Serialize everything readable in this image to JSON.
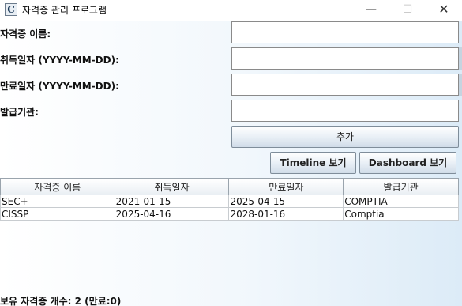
{
  "window": {
    "icon_letter": "C",
    "title": "자격증 관리 프로그램",
    "minimize_glyph": "—",
    "maximize_glyph": "☐",
    "close_glyph": "✕"
  },
  "form": {
    "name_label": "자격증 이름:",
    "name_value": "",
    "acquired_label": "취득일자 (YYYY-MM-DD):",
    "acquired_value": "",
    "expiry_label": "만료일자 (YYYY-MM-DD):",
    "expiry_value": "",
    "issuer_label": "발급기관:",
    "issuer_value": ""
  },
  "buttons": {
    "add": "추가",
    "timeline": "Timeline 보기",
    "dashboard": "Dashboard 보기"
  },
  "table": {
    "headers": [
      "자격증 이름",
      "취득일자",
      "만료일자",
      "발급기관"
    ],
    "rows": [
      [
        "SEC+",
        "2021-01-15",
        "2025-04-15",
        "COMPTIA"
      ],
      [
        "CISSP",
        "2025-04-16",
        "2028-01-16",
        "Comptia"
      ]
    ]
  },
  "status": {
    "text": "보유 자격증 개수: 2 (만료:0)"
  }
}
